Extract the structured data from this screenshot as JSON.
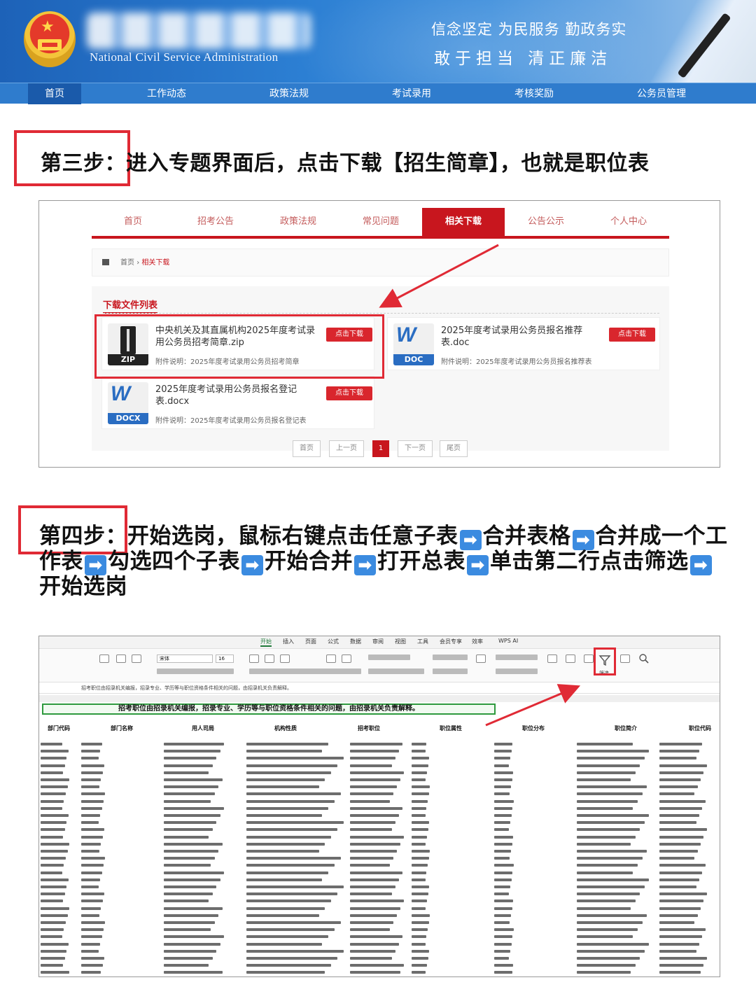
{
  "banner": {
    "logo_en": "National Civil Service Administration",
    "slogan_line1": "信念坚定  为民服务  勤政务实",
    "slogan_line2": "敢于担当   清正廉洁"
  },
  "nav": {
    "items": [
      "首页",
      "工作动态",
      "政策法规",
      "考试录用",
      "考核奖励",
      "公务员管理"
    ]
  },
  "step3": {
    "label": "第三步：",
    "text": "进入专题界面后，点击下载【招生简章】，也就是职位表"
  },
  "screenshot1": {
    "tabs": [
      "首页",
      "招考公告",
      "政策法规",
      "常见问题",
      "相关下载",
      "公告公示",
      "个人中心"
    ],
    "active_tab": "相关下载",
    "breadcrumb_home": "首页",
    "breadcrumb_sep": "›",
    "breadcrumb_current": "相关下载",
    "list_title": "下载文件列表",
    "files": [
      {
        "name": "中央机关及其直属机构2025年度考试录用公务员招考简章.zip",
        "type": "ZIP",
        "note": "附件说明：2025年度考试录用公务员招考简章",
        "button": "点击下载"
      },
      {
        "name": "2025年度考试录用公务员报名推荐表.doc",
        "type": "DOC",
        "note": "附件说明：2025年度考试录用公务员报名推荐表",
        "button": "点击下载"
      },
      {
        "name": "2025年度考试录用公务员报名登记表.docx",
        "type": "DOCX",
        "note": "附件说明：2025年度考试录用公务员报名登记表",
        "button": "点击下载"
      }
    ],
    "pager": [
      "首页",
      "上一页",
      "1",
      "下一页",
      "尾页"
    ]
  },
  "step4": {
    "label": "第四步：",
    "parts": [
      "开始选岗，鼠标右键点击任意子表",
      "合并表格",
      "合并成一个工作表",
      "勾选四个子表",
      "开始合并",
      "打开总表",
      "单击第二行点击筛选",
      "开始选岗"
    ],
    "arrow": "➡"
  },
  "screenshot2": {
    "menus": [
      "开始",
      "插入",
      "页面",
      "公式",
      "数据",
      "审阅",
      "视图",
      "工具",
      "会员专享",
      "效率",
      "WPS AI"
    ],
    "active_menu": "开始",
    "font_name": "宋体",
    "font_size": "16",
    "formula_text": "招考职位由招录机关编报，招录专业、学历等与职位资格条件相关的问题，由招录机关负责解释。",
    "sheet_title": "招考职位由招录机关编报，招录专业、学历等与职位资格条件相关的问题，由招录机关负责解释。",
    "headers": [
      "部门代码",
      "部门名称",
      "用人司局",
      "机构性质",
      "招考职位",
      "职位属性",
      "职位分布",
      "职位简介",
      "职位代码"
    ],
    "filter_label": "筛选"
  },
  "colors": {
    "highlight_red": "#e02a35",
    "banner_blue": "#2c7fd3",
    "site_red": "#c8161e",
    "arrow_blue": "#3b8be0"
  }
}
